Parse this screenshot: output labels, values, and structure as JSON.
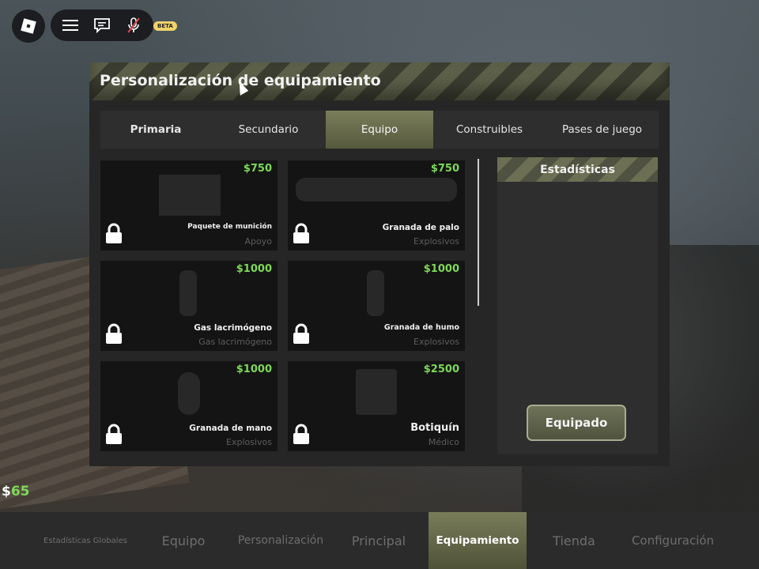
{
  "hud": {
    "beta": "BETA",
    "money_symbol": "$",
    "money_value": "65"
  },
  "panel": {
    "title": "Personalización de equipamiento"
  },
  "tabs": [
    {
      "label": "Primaria"
    },
    {
      "label": "Secundario"
    },
    {
      "label": "Equipo"
    },
    {
      "label": "Construibles"
    },
    {
      "label": "Pases de juego"
    }
  ],
  "items": [
    {
      "price": "$750",
      "name": "Paquete de munición",
      "category": "Apoyo"
    },
    {
      "price": "$750",
      "name": "Granada de palo",
      "category": "Explosivos"
    },
    {
      "price": "$1000",
      "name": "Gas lacrimógeno",
      "category": "Gas lacrimógeno"
    },
    {
      "price": "$1000",
      "name": "Granada de humo",
      "category": "Explosivos"
    },
    {
      "price": "$1000",
      "name": "Granada de mano",
      "category": "Explosivos"
    },
    {
      "price": "$2500",
      "name": "Botiquín",
      "category": "Médico"
    }
  ],
  "stats": {
    "title": "Estadísticas",
    "equip_button": "Equipado"
  },
  "bottom_nav": [
    {
      "label": "Estadísticas Globales"
    },
    {
      "label": "Equipo"
    },
    {
      "label": "Personalización"
    },
    {
      "label": "Principal"
    },
    {
      "label": "Equipamiento"
    },
    {
      "label": "Tienda"
    },
    {
      "label": "Configuración"
    }
  ],
  "colors": {
    "price_green": "#7ed957",
    "accent_olive": "#6e7258",
    "panel_bg": "#262626"
  }
}
